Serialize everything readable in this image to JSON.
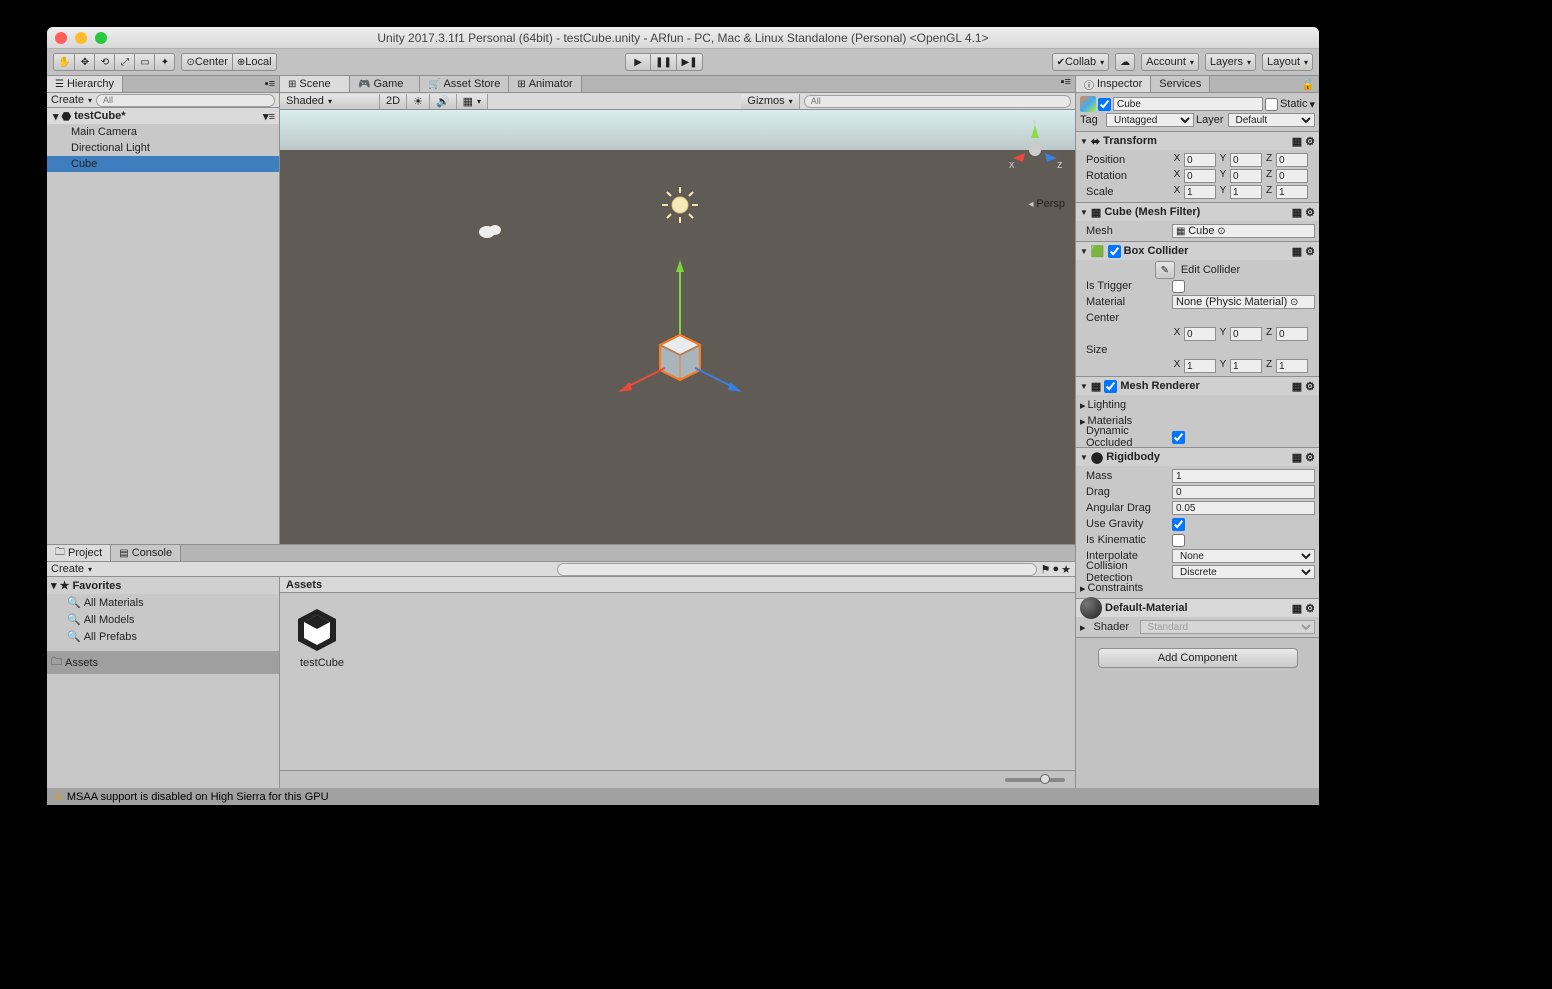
{
  "window": {
    "title": "Unity 2017.3.1f1 Personal (64bit) - testCube.unity - ARfun - PC, Mac & Linux Standalone (Personal) <OpenGL 4.1>"
  },
  "toolbar": {
    "center": "Center",
    "local": "Local",
    "collab": "Collab",
    "account": "Account",
    "layers": "Layers",
    "layout": "Layout"
  },
  "hierarchy": {
    "tab": "Hierarchy",
    "create": "Create",
    "searchPlaceholder": "All",
    "scene": "testCube*",
    "items": [
      "Main Camera",
      "Directional Light",
      "Cube"
    ],
    "selectedIndex": 2
  },
  "sceneTabs": {
    "scene": "Scene",
    "game": "Game",
    "assetStore": "Asset Store",
    "animator": "Animator"
  },
  "sceneBar": {
    "shading": "Shaded",
    "mode2d": "2D",
    "gizmos": "Gizmos",
    "searchPlaceholder": "All",
    "persp": "Persp"
  },
  "project": {
    "tabProject": "Project",
    "tabConsole": "Console",
    "create": "Create",
    "favorites": "Favorites",
    "favItems": [
      "All Materials",
      "All Models",
      "All Prefabs"
    ],
    "assetsFolder": "Assets",
    "crumb": "Assets",
    "asset0": "testCube"
  },
  "inspector": {
    "tabInspector": "Inspector",
    "tabServices": "Services",
    "objectName": "Cube",
    "static": "Static",
    "tagLabel": "Tag",
    "tagValue": "Untagged",
    "layerLabel": "Layer",
    "layerValue": "Default",
    "transform": {
      "title": "Transform",
      "position": "Position",
      "px": "0",
      "py": "0",
      "pz": "0",
      "rotation": "Rotation",
      "rx": "0",
      "ry": "0",
      "rz": "0",
      "scale": "Scale",
      "sx": "1",
      "sy": "1",
      "sz": "1"
    },
    "meshFilter": {
      "title": "Cube (Mesh Filter)",
      "meshLabel": "Mesh",
      "meshValue": "Cube"
    },
    "boxCollider": {
      "title": "Box Collider",
      "editCollider": "Edit Collider",
      "isTrigger": "Is Trigger",
      "material": "Material",
      "materialValue": "None (Physic Material)",
      "center": "Center",
      "cx": "0",
      "cy": "0",
      "cz": "0",
      "size": "Size",
      "szx": "1",
      "szy": "1",
      "szz": "1"
    },
    "meshRenderer": {
      "title": "Mesh Renderer",
      "lighting": "Lighting",
      "materials": "Materials",
      "dynOccluded": "Dynamic Occluded"
    },
    "rigidbody": {
      "title": "Rigidbody",
      "mass": "Mass",
      "massV": "1",
      "drag": "Drag",
      "dragV": "0",
      "angDrag": "Angular Drag",
      "angDragV": "0.05",
      "useGravity": "Use Gravity",
      "isKinematic": "Is Kinematic",
      "interpolate": "Interpolate",
      "interpolateV": "None",
      "collDet": "Collision Detection",
      "collDetV": "Discrete",
      "constraints": "Constraints"
    },
    "material": {
      "name": "Default-Material",
      "shaderLabel": "Shader",
      "shaderValue": "Standard"
    },
    "addComponent": "Add Component"
  },
  "statusbar": {
    "warning": "MSAA support is disabled on High Sierra for this GPU"
  }
}
